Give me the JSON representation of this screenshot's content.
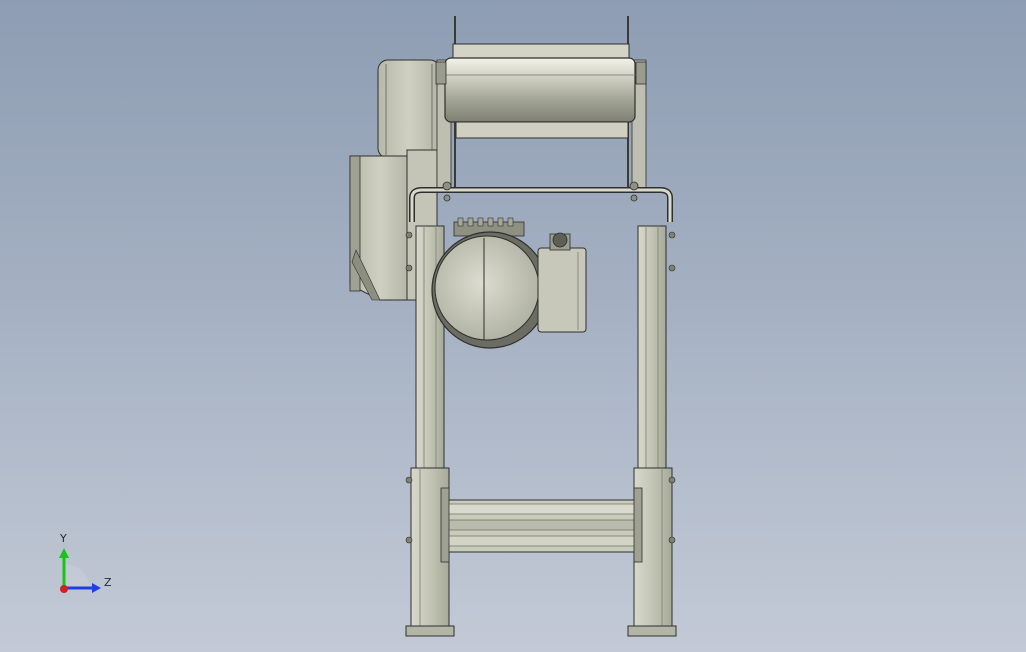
{
  "axes": {
    "y_label": "Y",
    "z_label": "Z",
    "y_color": "#19c419",
    "z_color": "#1f3fe0",
    "x_color": "#d42020"
  },
  "model": {
    "view": "side elevation",
    "body_color": "#c9cbbb",
    "outline_color": "#2f2f2f"
  }
}
